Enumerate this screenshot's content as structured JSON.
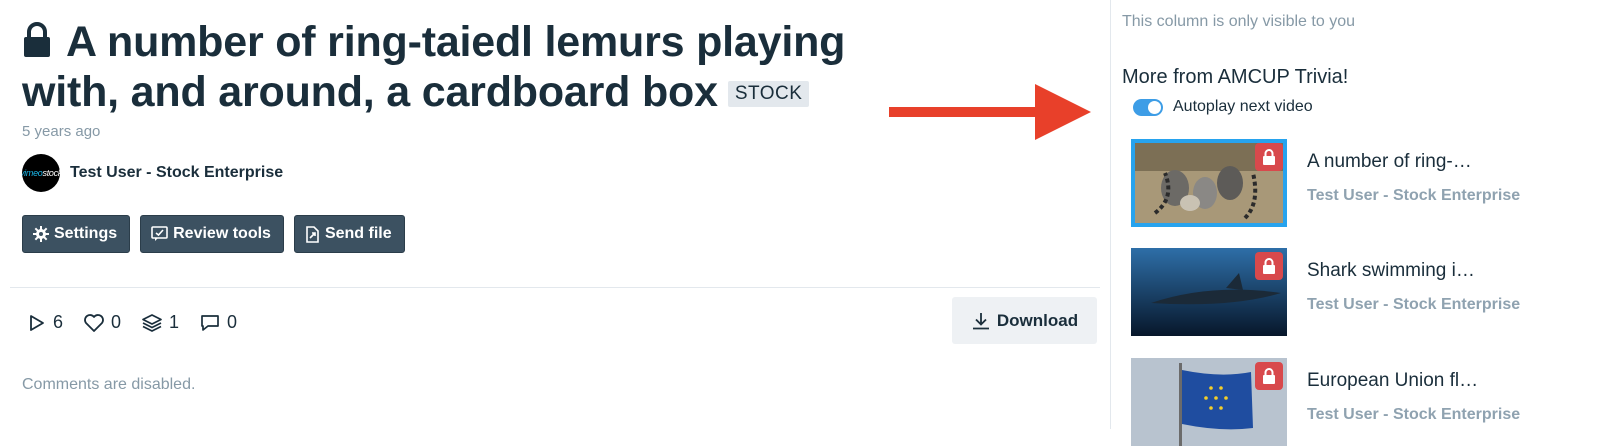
{
  "video": {
    "title": "A number of ring-taiedl lemurs playing with, and around, a cardboard box",
    "badge": "STOCK",
    "time_ago": "5 years ago",
    "owner_name": "Test User - Stock Enterprise",
    "avatar_text_a": "vimeo",
    "avatar_text_b": "stock"
  },
  "actions": {
    "settings_label": "Settings",
    "review_label": "Review tools",
    "send_label": "Send file"
  },
  "stats": {
    "plays": "6",
    "likes": "0",
    "collections": "1",
    "comments": "0"
  },
  "download_label": "Download",
  "comments_status": "Comments are disabled.",
  "sidebar": {
    "note": "This column is only visible to you",
    "title": "More from AMCUP Trivia!",
    "autoplay_label": "Autoplay next video",
    "autoplay_on": true,
    "items": [
      {
        "title": "A number of ring-…",
        "owner": "Test User - Stock Enterprise"
      },
      {
        "title": "Shark swimming i…",
        "owner": "Test User - Stock Enterprise"
      },
      {
        "title": "European Union fl…",
        "owner": "Test User - Stock Enterprise"
      }
    ]
  },
  "colors": {
    "button_bg": "#3c5161",
    "accent": "#27a3ee",
    "lock_badge": "#d8494c",
    "arrow": "#e8402a"
  }
}
